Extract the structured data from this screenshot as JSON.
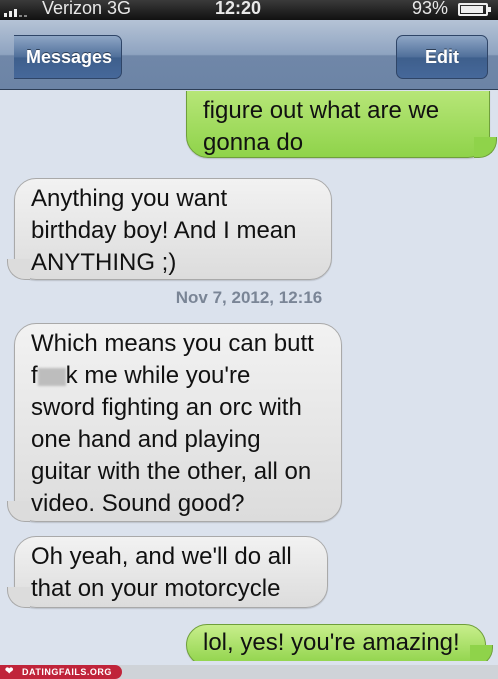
{
  "status_bar": {
    "carrier": "Verizon  3G",
    "time": "12:20",
    "battery": "93%"
  },
  "nav": {
    "back_label": "Messages",
    "edit_label": "Edit"
  },
  "messages": [
    {
      "direction": "out",
      "text": "figure out what are we\ngonna do"
    },
    {
      "direction": "in",
      "text": "Anything you want\nbirthday boy! And I mean\nANYTHING ;)"
    },
    {
      "direction": "in",
      "text_before": "Which means you can butt\nf",
      "text_after": "k me while you're\nsword fighting an orc with\none hand and playing\nguitar with the other, all on\nvideo. Sound good?"
    },
    {
      "direction": "in",
      "text": "Oh yeah, and we'll do all\nthat on your motorcycle"
    },
    {
      "direction": "out",
      "text": "lol, yes! you're amazing!"
    }
  ],
  "timestamp": "Nov 7, 2012, 12:16",
  "watermark": "DATINGFAILS.ORG",
  "colors": {
    "outgoing_bubble": "#8fd34a",
    "incoming_bubble": "#dcdcdc",
    "nav_bar": "#6c84a6",
    "watermark_bg": "#c0243a"
  }
}
